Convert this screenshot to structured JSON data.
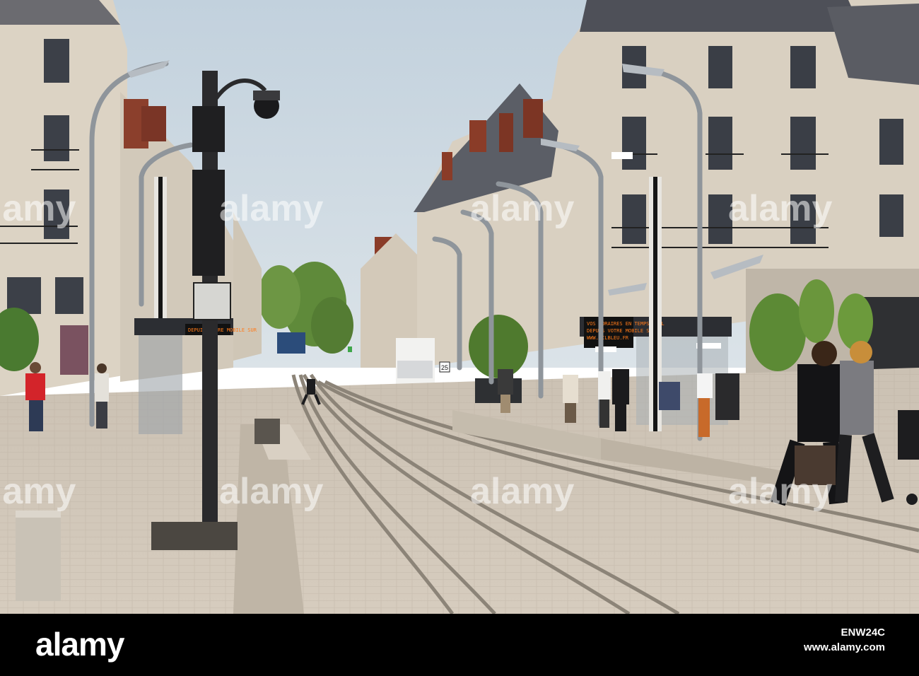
{
  "footer": {
    "logo": "alamy",
    "image_id": "ENW24C",
    "site": "www.alamy.com"
  },
  "watermarks": [
    "alamy",
    "alamy",
    "alamy",
    "alamy",
    "alamy",
    "alamy",
    "alamy",
    "alamy"
  ],
  "stop_signs": {
    "left": [
      "DEPUIS VOTRE MOBILE SUR"
    ],
    "right": [
      "VOS HORAIRES EN TEMPS RÉEL",
      "DEPUIS VOTRE MOBILE SUR",
      "WWW.FILBLEU.FR"
    ]
  },
  "route_number": "25",
  "colors": {
    "sky": "#c9d6e0",
    "building": "#d8d0c2",
    "pavement": "#cfc5b7",
    "footer": "#000000"
  }
}
